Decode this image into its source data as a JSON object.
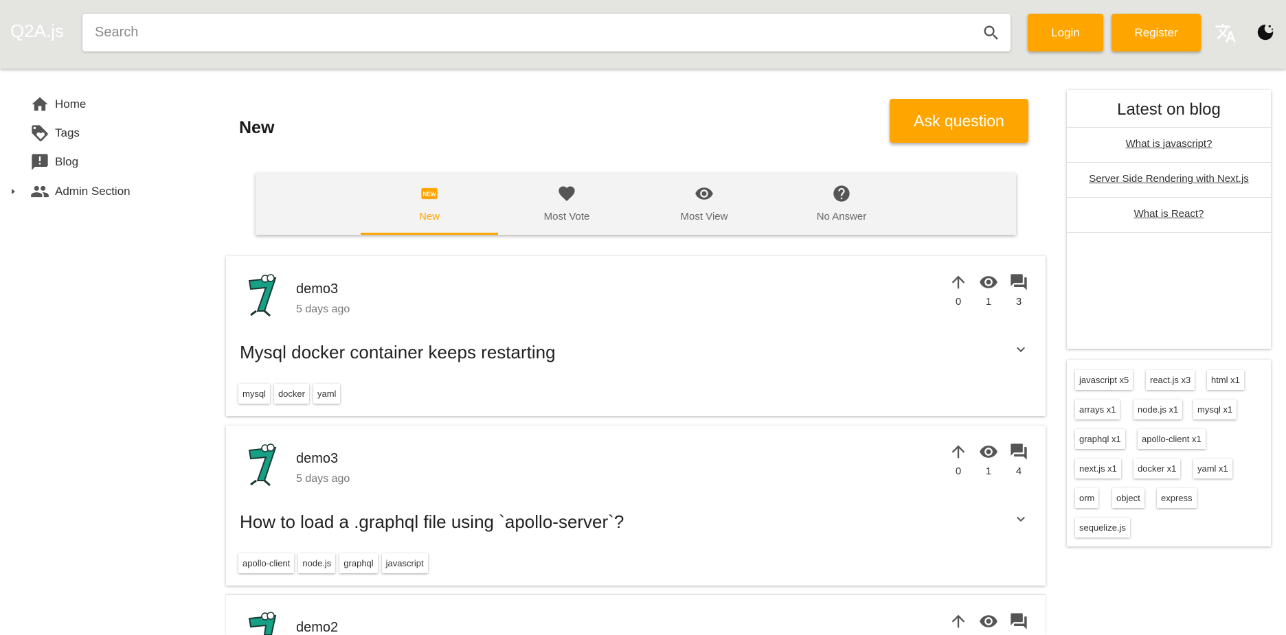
{
  "header": {
    "logo": "Q2A.js",
    "search_placeholder": "Search",
    "login_label": "Login",
    "register_label": "Register",
    "accent_color": "#ffa500"
  },
  "nav": {
    "items": [
      {
        "label": "Home",
        "icon": "home-icon"
      },
      {
        "label": "Tags",
        "icon": "tag-icon"
      },
      {
        "label": "Blog",
        "icon": "blog-icon"
      },
      {
        "label": "Admin Section",
        "icon": "people-icon"
      }
    ]
  },
  "main": {
    "title": "New",
    "ask_label": "Ask question",
    "tabs": [
      {
        "label": "New",
        "icon": "new-badge-icon",
        "active": true
      },
      {
        "label": "Most Vote",
        "icon": "heart-icon",
        "active": false
      },
      {
        "label": "Most View",
        "icon": "eye-icon",
        "active": false
      },
      {
        "label": "No Answer",
        "icon": "question-icon",
        "active": false
      }
    ],
    "questions": [
      {
        "author": "demo3",
        "time": "5 days ago",
        "votes": "0",
        "views": "1",
        "answers": "3",
        "title": "Mysql docker container keeps restarting",
        "tags": [
          "mysql",
          "docker",
          "yaml"
        ]
      },
      {
        "author": "demo3",
        "time": "5 days ago",
        "votes": "0",
        "views": "1",
        "answers": "4",
        "title": "How to load a .graphql file using `apollo-server`?",
        "tags": [
          "apollo-client",
          "node.js",
          "graphql",
          "javascript"
        ]
      },
      {
        "author": "demo2"
      }
    ]
  },
  "sidebar": {
    "blog_title": "Latest on blog",
    "blog_links": [
      "What is javascript?",
      "Server Side Rendering with Next.js",
      "What is React?"
    ],
    "tag_chips": [
      "javascript x5",
      "react.js x3",
      "html x1",
      "arrays x1",
      "node.js x1",
      "mysql x1",
      "graphql x1",
      "apollo-client x1",
      "next.js x1",
      "docker x1",
      "yaml x1",
      "orm",
      "object",
      "express",
      "sequelize.js"
    ]
  }
}
